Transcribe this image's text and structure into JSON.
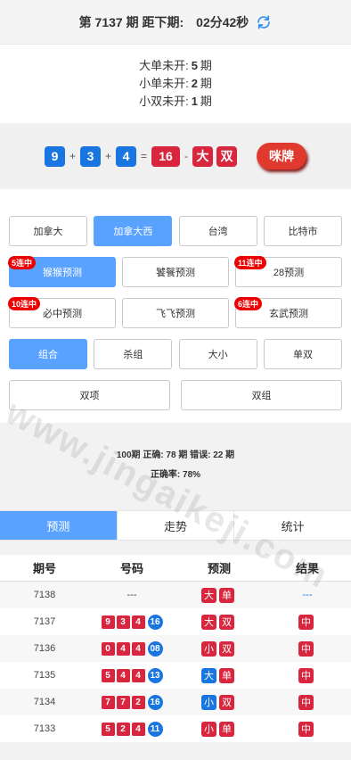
{
  "header": {
    "issue_text": "第 7137 期 距下期:",
    "countdown": "02分42秒",
    "refresh_icon": "refresh-icon",
    "accent": "#2d8cf0"
  },
  "missing": [
    {
      "label": "大单未开:",
      "value": "5",
      "unit": "期"
    },
    {
      "label": "小单未开:",
      "value": "2",
      "unit": "期"
    },
    {
      "label": "小双未开:",
      "value": "1",
      "unit": "期"
    }
  ],
  "result": {
    "n1": "9",
    "n2": "3",
    "n3": "4",
    "sum": "16",
    "size": "大",
    "parity": "双",
    "plus": "+",
    "eq": "=",
    "dash": "-",
    "mimi_label": "咪牌"
  },
  "regions": [
    "加拿大",
    "加拿大西",
    "台湾",
    "比特市"
  ],
  "predictors": [
    {
      "label": "猴猴预测",
      "badge": "5连中"
    },
    {
      "label": "饕餮预测",
      "badge": ""
    },
    {
      "label": "28预测",
      "badge": "11连中"
    },
    {
      "label": "必中预测",
      "badge": "10连中"
    },
    {
      "label": "飞飞预测",
      "badge": ""
    },
    {
      "label": "玄武预测",
      "badge": "6连中"
    }
  ],
  "modes": [
    "组合",
    "杀组",
    "大小",
    "单双"
  ],
  "modes2": [
    "双项",
    "双组"
  ],
  "stats": {
    "line1": "100期 正确: 78 期 错误: 22 期",
    "line2": "正确率: 78%"
  },
  "bottom_tabs": [
    "预测",
    "走势",
    "统计"
  ],
  "table": {
    "headers": [
      "期号",
      "号码",
      "预测",
      "结果"
    ],
    "rows": [
      {
        "issue": "7138",
        "nums": [],
        "sum": "",
        "pending_nums": "---",
        "pred": [
          "大",
          "单"
        ],
        "pred_colors": [
          "red",
          "red"
        ],
        "result": "---"
      },
      {
        "issue": "7137",
        "nums": [
          "9",
          "3",
          "4"
        ],
        "sum": "16",
        "pred": [
          "大",
          "双"
        ],
        "pred_colors": [
          "red",
          "red"
        ],
        "result": "中"
      },
      {
        "issue": "7136",
        "nums": [
          "0",
          "4",
          "4"
        ],
        "sum": "08",
        "pred": [
          "小",
          "双"
        ],
        "pred_colors": [
          "red",
          "red"
        ],
        "result": "中"
      },
      {
        "issue": "7135",
        "nums": [
          "5",
          "4",
          "4"
        ],
        "sum": "13",
        "pred": [
          "大",
          "单"
        ],
        "pred_colors": [
          "blue",
          "red"
        ],
        "result": "中"
      },
      {
        "issue": "7134",
        "nums": [
          "7",
          "7",
          "2"
        ],
        "sum": "16",
        "pred": [
          "小",
          "双"
        ],
        "pred_colors": [
          "blue",
          "red"
        ],
        "result": "中"
      },
      {
        "issue": "7133",
        "nums": [
          "5",
          "2",
          "4"
        ],
        "sum": "11",
        "pred": [
          "小",
          "单"
        ],
        "pred_colors": [
          "red",
          "red"
        ],
        "result": "中"
      }
    ]
  },
  "watermark": "www.jingaikeji.com"
}
